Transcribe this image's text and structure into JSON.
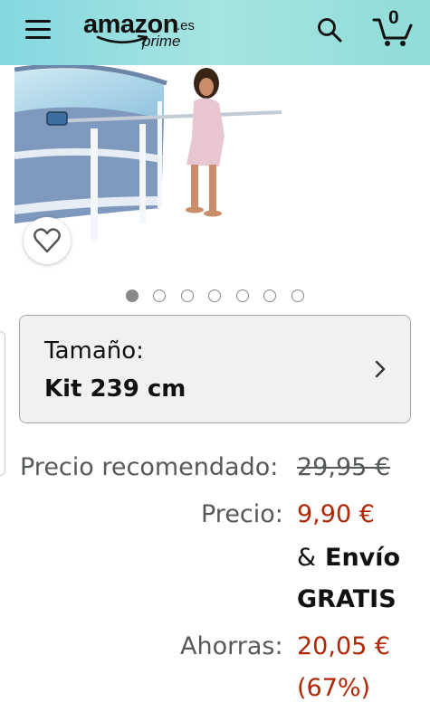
{
  "header": {
    "logo_word": "amazon",
    "logo_tld": ".es",
    "logo_prime": "prime",
    "cart_count": "0",
    "icons": [
      "menu-icon",
      "search-icon",
      "cart-icon"
    ],
    "colors": {
      "header_bg": "#9fe1de",
      "price_red": "#b12704"
    }
  },
  "product": {
    "carousel": {
      "total": 7,
      "active": 1
    },
    "wishlist_icon": "heart-icon"
  },
  "size": {
    "label": "Tamaño:",
    "value": "Kit 239 cm"
  },
  "pricing": {
    "rrp_label": "Precio recomendado:",
    "rrp_value": "29,95 €",
    "price_label": "Precio:",
    "price_value": "9,90 €",
    "shipping_amp": "&",
    "shipping_word": "Envío",
    "shipping_free": "GRATIS",
    "save_label": "Ahorras:",
    "save_value": "20,05 €",
    "save_pct": "(67%)"
  }
}
